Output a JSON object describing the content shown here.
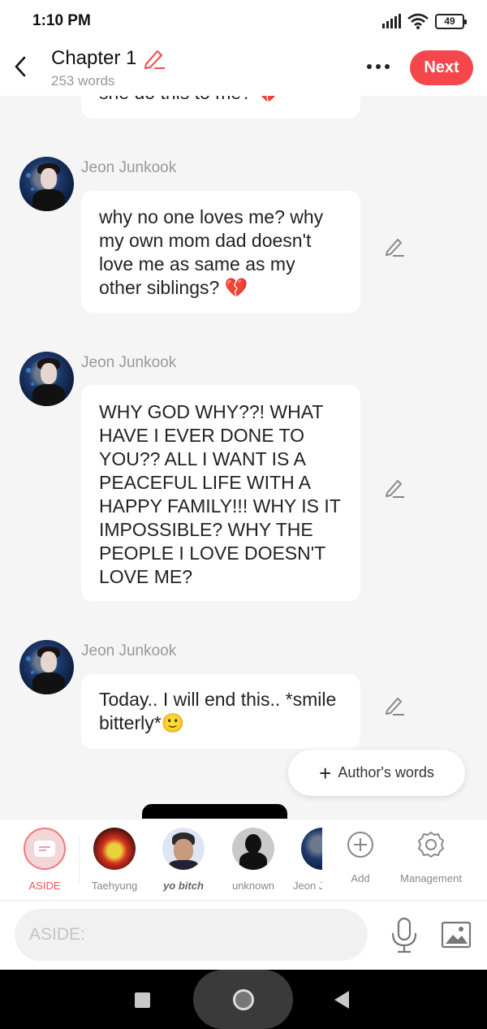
{
  "status_bar": {
    "time": "1:10 PM",
    "battery": "49"
  },
  "header": {
    "title": "Chapter 1",
    "subtitle": "253 words",
    "next_label": "Next"
  },
  "messages": [
    {
      "sender": "",
      "text": "she do this to me? 💔"
    },
    {
      "sender": "Jeon Junkook",
      "text": "why no one loves me? why my own mom dad doesn't love me as same as my other siblings? 💔"
    },
    {
      "sender": "Jeon Junkook",
      "text": "WHY GOD WHY??! WHAT HAVE I EVER DONE TO YOU?? ALL I WANT IS A PEACEFUL LIFE WITH A HAPPY FAMILY!!! WHY IS IT IMPOSSIBLE? WHY THE PEOPLE I LOVE DOESN'T LOVE ME?"
    },
    {
      "sender": "Jeon Junkook",
      "text": "Today.. I will end this.. *smile bitterly*🙂"
    }
  ],
  "authors_words_label": "Author's words",
  "characters": [
    {
      "label": "ASIDE",
      "active": true
    },
    {
      "label": "Taehyung"
    },
    {
      "label": "yo bitch"
    },
    {
      "label": "unknown"
    },
    {
      "label": "Jeon Junkook"
    }
  ],
  "tools": {
    "add_label": "Add",
    "management_label": "Management"
  },
  "input": {
    "placeholder": "ASIDE:",
    "value": ""
  }
}
